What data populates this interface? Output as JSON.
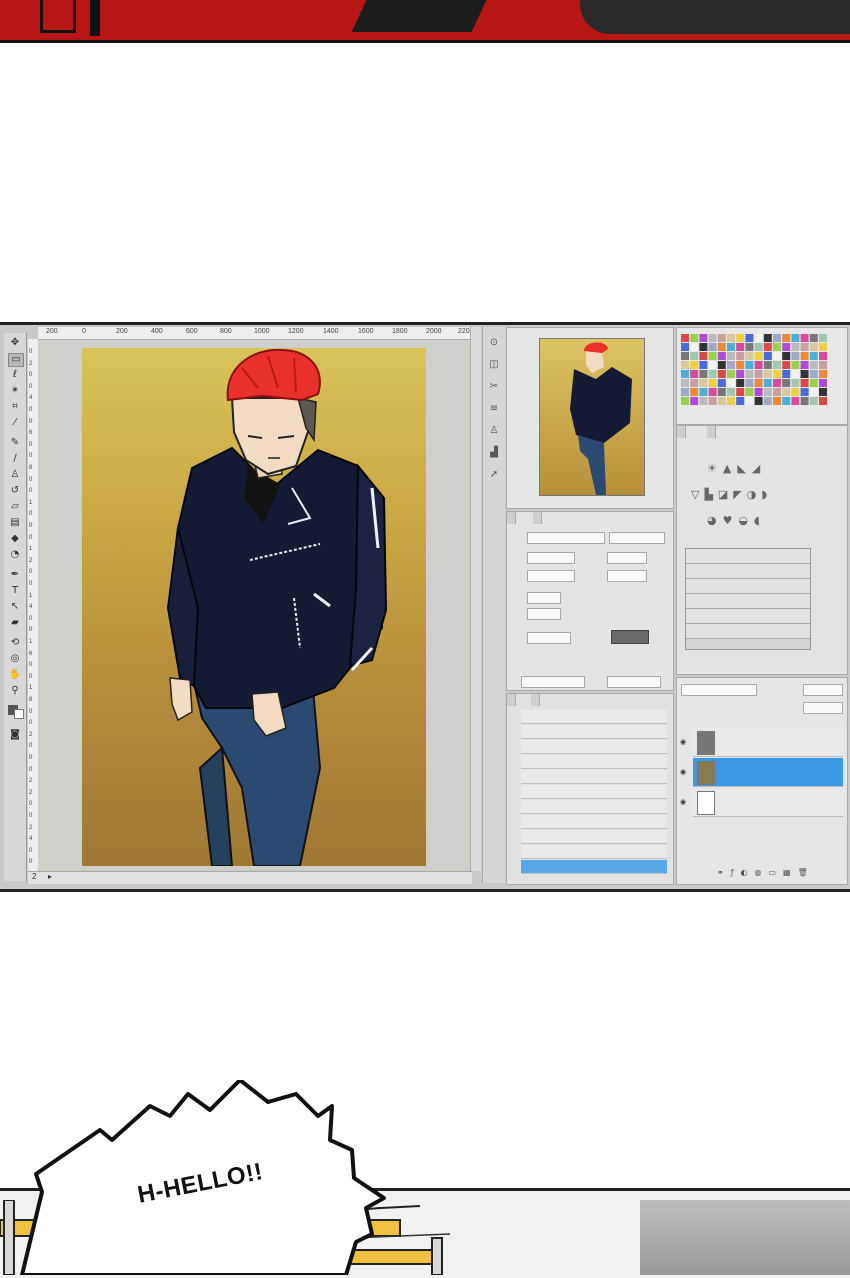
{
  "bubble": {
    "text": "H-HELLO!!"
  },
  "photoshop": {
    "ruler_labels": [
      "200",
      "0",
      "200",
      "400",
      "600",
      "800",
      "1000",
      "1200",
      "1400",
      "1600",
      "1800",
      "2000",
      "220"
    ],
    "vertical_ruler_labels": [
      "0",
      "2",
      "0",
      "0",
      "4",
      "0",
      "0",
      "6",
      "0",
      "0",
      "8",
      "0",
      "0",
      "1",
      "0",
      "0",
      "0",
      "1",
      "2",
      "0",
      "0",
      "1",
      "4",
      "0",
      "0",
      "1",
      "6",
      "0",
      "0",
      "1",
      "8",
      "0",
      "0",
      "2",
      "0",
      "0",
      "0",
      "2",
      "2",
      "0",
      "0",
      "2",
      "4",
      "0",
      "0"
    ],
    "status_zoom": "2"
  },
  "colors": {
    "hair": "#e8312a",
    "jacket": "#141a33",
    "jeans": "#2b4a72",
    "canvas_top": "#d9c35a",
    "canvas_bottom": "#a07733",
    "selection": "#3d98e3",
    "top_strip": "#b81616"
  },
  "icons": [
    "move-tool-icon",
    "marquee-tool-icon",
    "lasso-tool-icon",
    "magic-wand-icon",
    "crop-tool-icon",
    "eyedropper-icon",
    "brush-tool-icon",
    "clone-stamp-icon",
    "eraser-icon",
    "gradient-icon",
    "blur-icon",
    "dodge-icon",
    "pen-tool-icon",
    "type-tool-icon",
    "path-select-icon",
    "shape-tool-icon",
    "hand-tool-icon",
    "zoom-tool-icon",
    "eye-icon"
  ]
}
